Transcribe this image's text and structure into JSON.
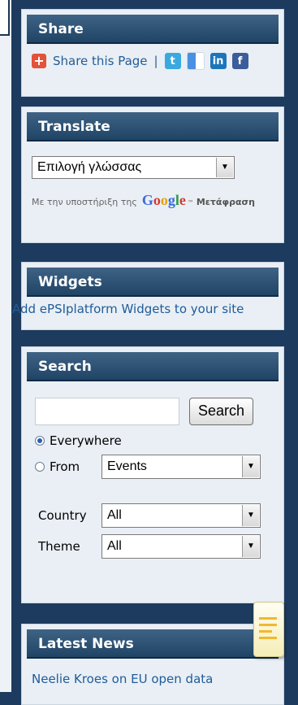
{
  "share": {
    "title": "Share",
    "label": "Share this Page",
    "separator": "|",
    "icons": [
      "plus-icon",
      "twitter-icon",
      "delicious-icon",
      "linkedin-icon",
      "facebook-icon"
    ],
    "icon_text": {
      "plus": "+",
      "twitter": "t",
      "linkedin": "in",
      "facebook": "f"
    }
  },
  "translate": {
    "title": "Translate",
    "select_value": "Επιλογή γλώσσας",
    "powered_prefix": "Με την υποστήριξη της",
    "google": [
      "G",
      "o",
      "o",
      "g",
      "l",
      "e"
    ],
    "tm": "™",
    "powered_suffix": "Μετάφραση"
  },
  "widgets": {
    "title": "Widgets",
    "link": "Add ePSIplatform Widgets to your site"
  },
  "search": {
    "title": "Search",
    "input_value": "",
    "button_label": "Search",
    "everywhere_label": "Everywhere",
    "from_label": "From",
    "from_value": "Events",
    "country_label": "Country",
    "country_value": "All",
    "theme_label": "Theme",
    "theme_value": "All"
  },
  "latest_news": {
    "title": "Latest News",
    "first_item": "Neelie Kroes on EU open data"
  },
  "colors": {
    "background": "#1d3b5e",
    "panel": "#e9eff5",
    "header": "#2e5376",
    "link": "#1f5c99"
  }
}
